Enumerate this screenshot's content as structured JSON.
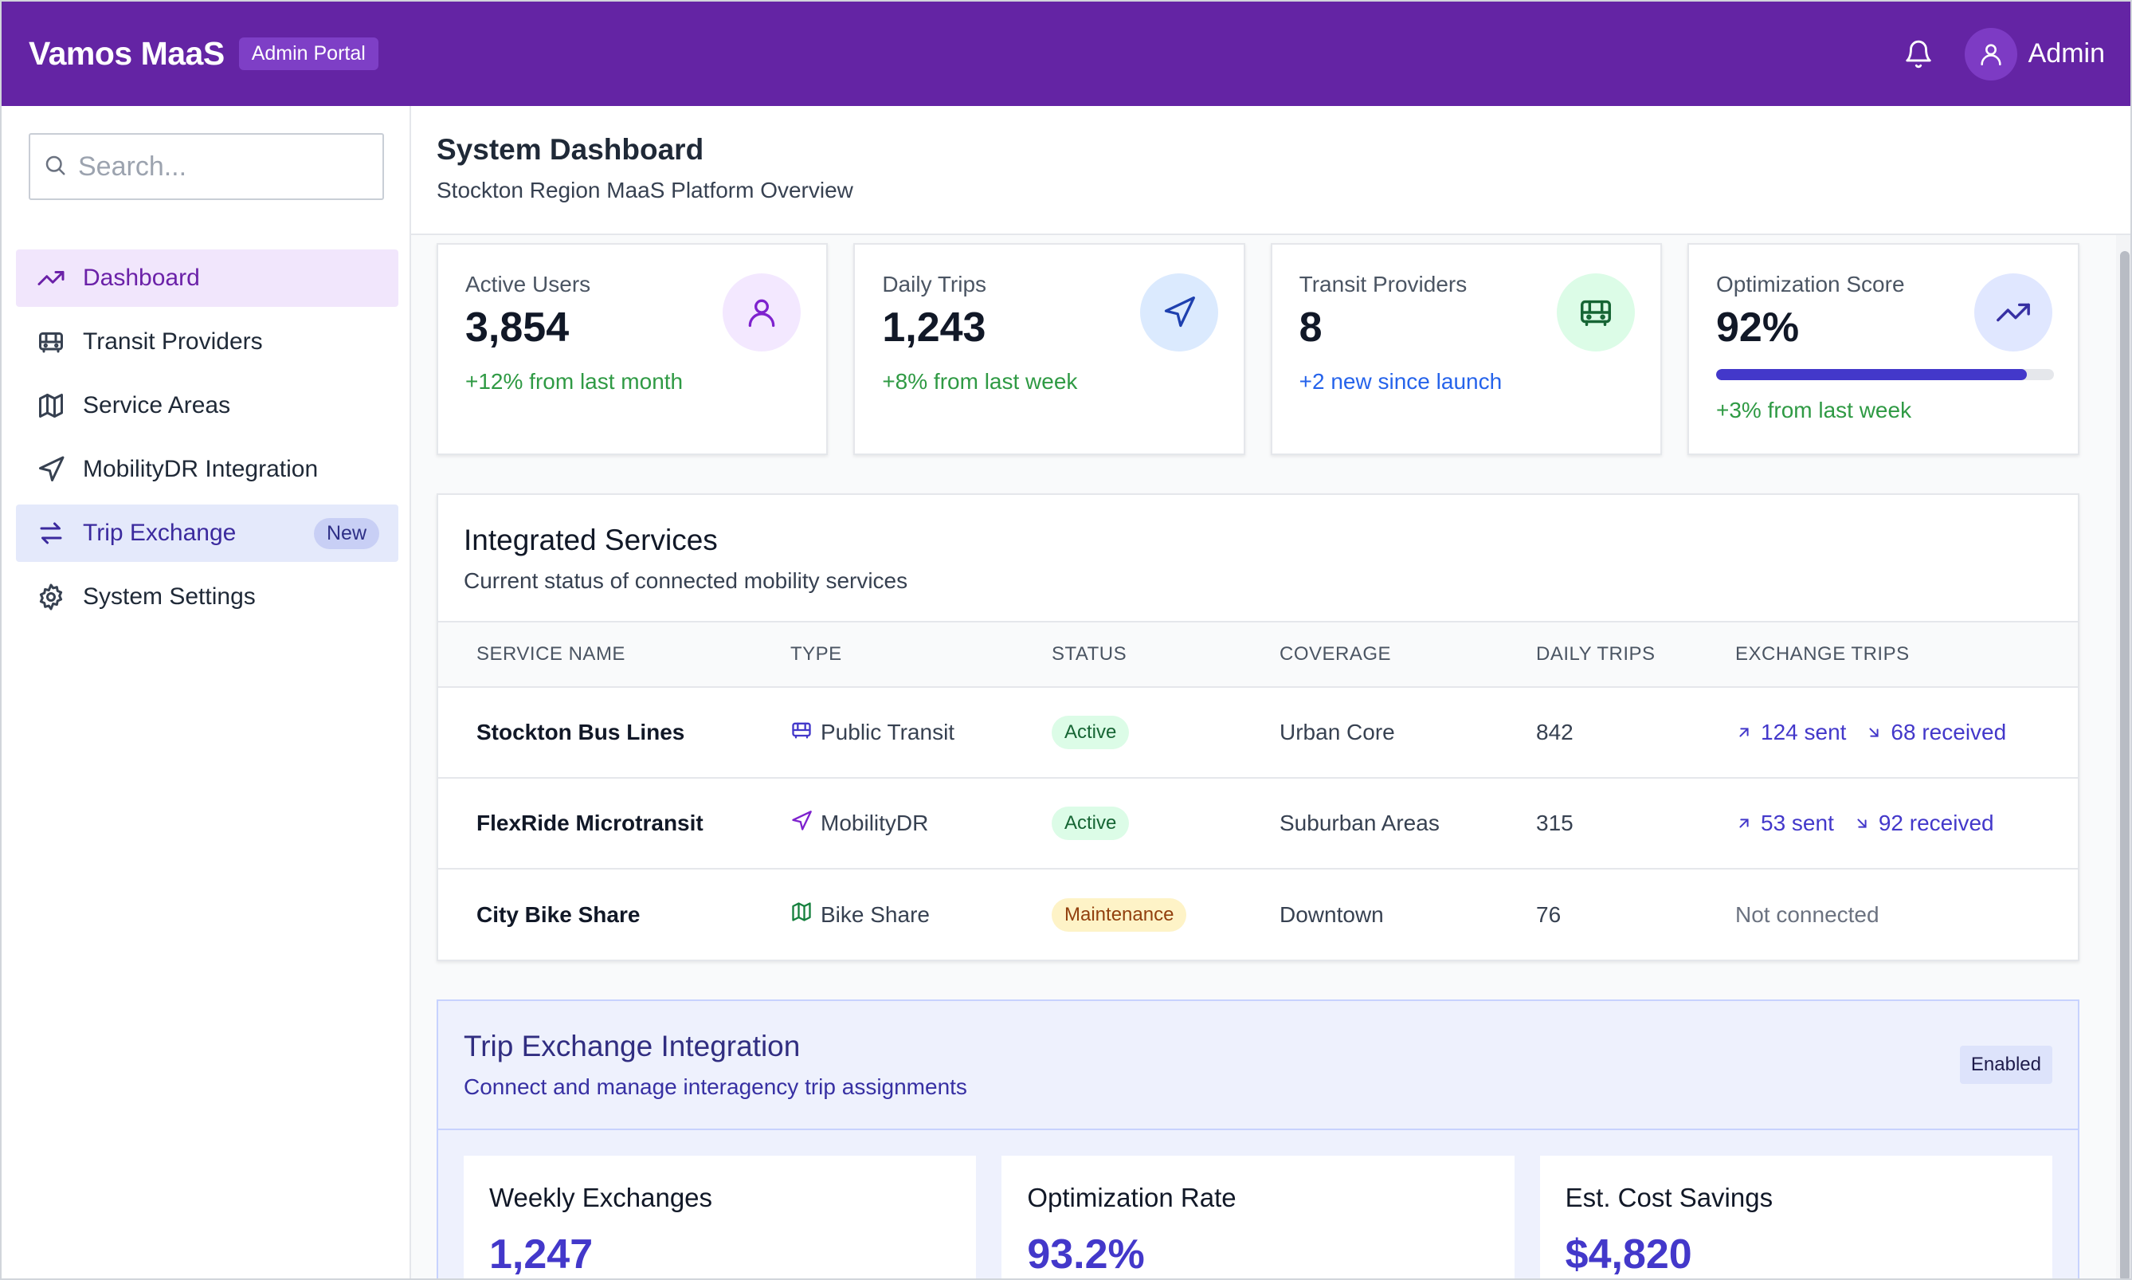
{
  "header": {
    "brand": "Vamos MaaS",
    "portal_badge": "Admin Portal",
    "user_name": "Admin"
  },
  "sidebar": {
    "search_placeholder": "Search...",
    "items": [
      {
        "label": "Dashboard",
        "icon": "trending-up-icon"
      },
      {
        "label": "Transit Providers",
        "icon": "bus-icon"
      },
      {
        "label": "Service Areas",
        "icon": "map-icon"
      },
      {
        "label": "MobilityDR Integration",
        "icon": "navigation-icon"
      },
      {
        "label": "Trip Exchange",
        "icon": "swap-arrows-icon",
        "badge": "New"
      },
      {
        "label": "System Settings",
        "icon": "gear-icon"
      }
    ]
  },
  "page": {
    "title": "System Dashboard",
    "subtitle": "Stockton Region MaaS Platform Overview"
  },
  "stats": [
    {
      "label": "Active Users",
      "value": "3,854",
      "note": "+12% from last month"
    },
    {
      "label": "Daily Trips",
      "value": "1,243",
      "note": "+8% from last week"
    },
    {
      "label": "Transit Providers",
      "value": "8",
      "note": "+2 new since launch"
    },
    {
      "label": "Optimization Score",
      "value": "92%",
      "note": "+3% from last week",
      "progress": 0.92
    }
  ],
  "services": {
    "title": "Integrated Services",
    "subtitle": "Current status of connected mobility services",
    "columns": [
      "SERVICE NAME",
      "TYPE",
      "STATUS",
      "COVERAGE",
      "DAILY TRIPS",
      "EXCHANGE TRIPS"
    ],
    "rows": [
      {
        "name": "Stockton Bus Lines",
        "type": "Public Transit",
        "type_icon": "bus-icon",
        "status": "Active",
        "coverage": "Urban Core",
        "daily_trips": "842",
        "sent": "124 sent",
        "received": "68 received"
      },
      {
        "name": "FlexRide Microtransit",
        "type": "MobilityDR",
        "type_icon": "navigation-icon",
        "status": "Active",
        "coverage": "Suburban Areas",
        "daily_trips": "315",
        "sent": "53 sent",
        "received": "92 received"
      },
      {
        "name": "City Bike Share",
        "type": "Bike Share",
        "type_icon": "map-icon",
        "status": "Maintenance",
        "coverage": "Downtown",
        "daily_trips": "76",
        "exchange": "Not connected"
      }
    ]
  },
  "trip_exchange": {
    "title": "Trip Exchange Integration",
    "subtitle": "Connect and manage interagency trip assignments",
    "badge": "Enabled",
    "metrics": [
      {
        "label": "Weekly Exchanges",
        "value": "1,247"
      },
      {
        "label": "Optimization Rate",
        "value": "93.2%"
      },
      {
        "label": "Est. Cost Savings",
        "value": "$4,820"
      }
    ]
  },
  "colors": {
    "header_bg": "#6424a4",
    "accent": "#4338ca",
    "positive": "#2f9a44",
    "info": "#2563eb"
  }
}
